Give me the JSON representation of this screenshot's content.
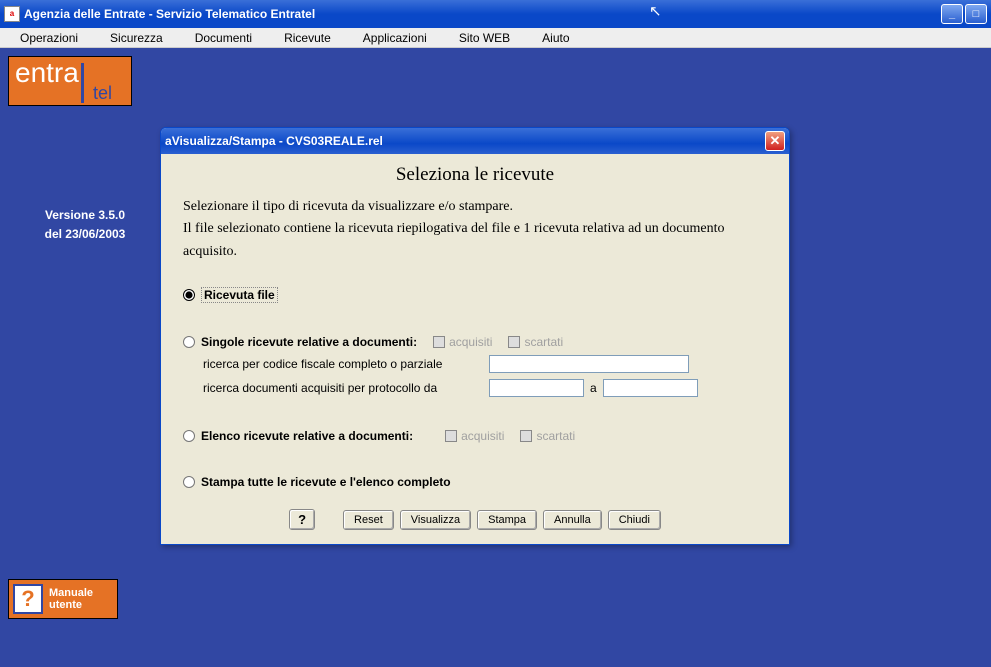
{
  "window": {
    "title": "Agenzia delle Entrate - Servizio Telematico Entratel"
  },
  "menu": {
    "items": [
      "Operazioni",
      "Sicurezza",
      "Documenti",
      "Ricevute",
      "Applicazioni",
      "Sito WEB",
      "Aiuto"
    ]
  },
  "sidebar": {
    "logo_entra": "entra",
    "logo_tel": "tel",
    "version_line1": "Versione 3.5.0",
    "version_line2": "del 23/06/2003",
    "manual_line1": "Manuale",
    "manual_line2": "utente"
  },
  "dialog": {
    "title": "Visualizza/Stampa - CVS03REALE.rel",
    "heading": "Seleziona le ricevute",
    "desc_line1": "Selezionare il tipo di ricevuta da visualizzare e/o stampare.",
    "desc_line2": "Il file selezionato contiene la ricevuta riepilogativa del file e 1 ricevuta relativa ad un documento acquisito.",
    "opt1": "Ricevuta file",
    "opt2": "Singole ricevute relative a documenti:",
    "opt2_chk1": "acquisiti",
    "opt2_chk2": "scartati",
    "opt2_sub1": "ricerca per codice fiscale completo o parziale",
    "opt2_sub2": "ricerca documenti acquisiti per protocollo  da",
    "opt2_sub2_sep": "a",
    "opt3": "Elenco ricevute relative a documenti:",
    "opt3_chk1": "acquisiti",
    "opt3_chk2": "scartati",
    "opt4": "Stampa tutte le ricevute e l'elenco completo",
    "buttons": {
      "help": "?",
      "reset": "Reset",
      "visualizza": "Visualizza",
      "stampa": "Stampa",
      "annulla": "Annulla",
      "chiudi": "Chiudi"
    }
  }
}
